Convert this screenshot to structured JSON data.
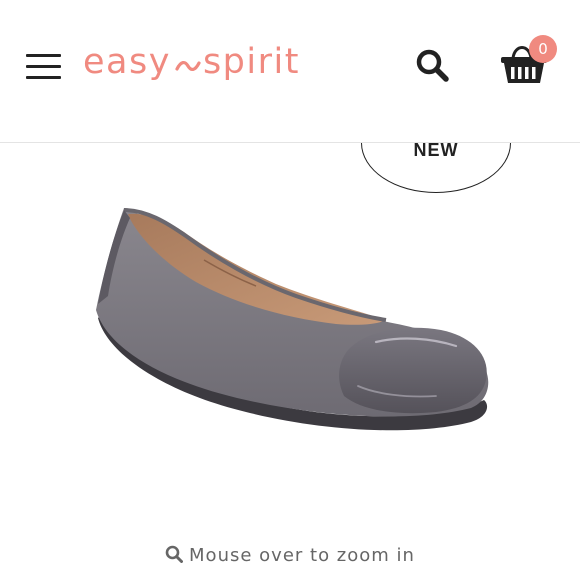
{
  "header": {
    "logo_text_left": "easy",
    "logo_text_right": "spirit",
    "cart_count": "0"
  },
  "product": {
    "badge_label": "NEW",
    "zoom_hint": "Mouse over to zoom in"
  },
  "icons": [
    "menu-icon",
    "search-icon",
    "cart-icon",
    "zoom-icon"
  ],
  "colors": {
    "brand": "#f08a80",
    "icon": "#222222",
    "hint_text": "#666666"
  }
}
